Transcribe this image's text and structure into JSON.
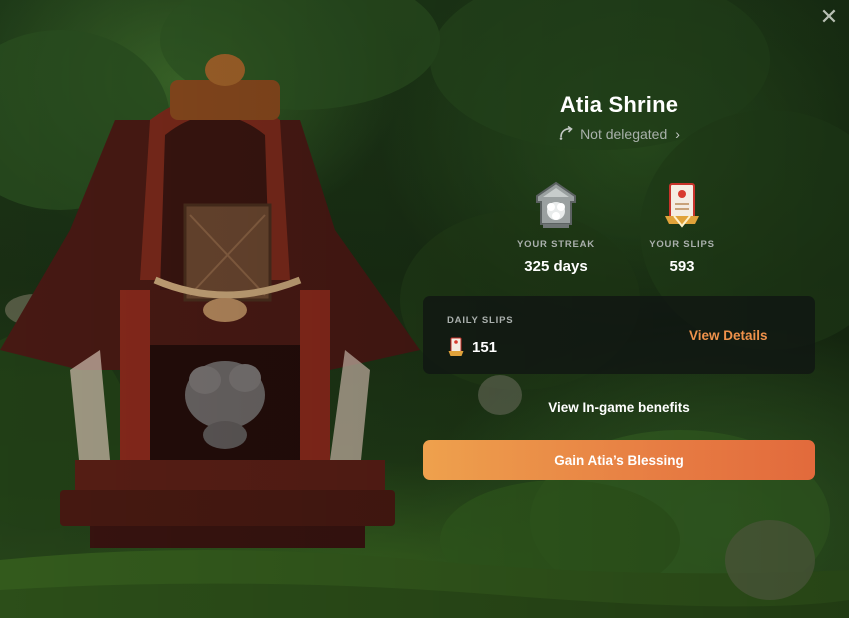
{
  "modal": {
    "title": "Atia Shrine",
    "close_icon": "close-icon",
    "delegation": {
      "icon": "delegate-arrow-icon",
      "status": "Not delegated",
      "chevron": "›"
    },
    "stats": {
      "streak": {
        "icon": "shrine-badge-icon",
        "label": "YOUR STREAK",
        "value": "325 days"
      },
      "slips": {
        "icon": "slip-scroll-icon",
        "label": "YOUR SLIPS",
        "value": "593"
      }
    },
    "daily_slips": {
      "label": "DAILY SLIPS",
      "icon": "slip-scroll-icon",
      "count": "151",
      "link_label": "View Details"
    },
    "benefits_link": "View In-game benefits",
    "cta_label": "Gain Atia’s Blessing"
  },
  "colors": {
    "accent_orange": "#f0924b",
    "button_gradient_start": "#eea14d",
    "button_gradient_end": "#e26a3c",
    "card_background": "#101412",
    "muted_text": "#aab0ad"
  }
}
